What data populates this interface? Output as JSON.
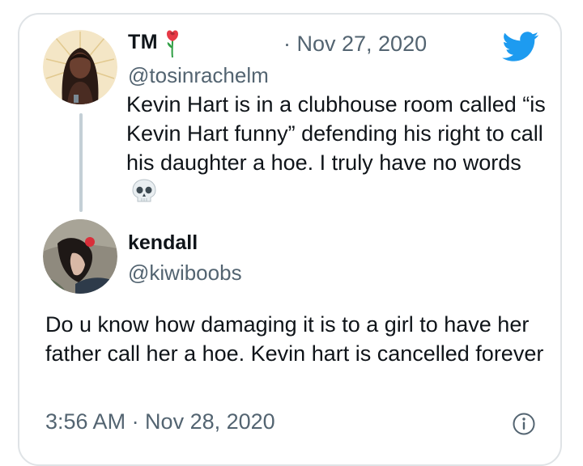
{
  "quoted_tweet": {
    "display_name": "TM",
    "name_icon": "rose-icon",
    "date": "· Nov 27, 2020",
    "handle": "@tosinrachelm",
    "text": "Kevin Hart is in a clubhouse room called “is Kevin Hart funny” defending his right to call his daughter a hoe. I truly have no words",
    "trailing_icon": "skull-icon"
  },
  "reply_tweet": {
    "display_name": "kendall",
    "handle": "@kiwiboobs",
    "text": "Do u know how damaging it is to a girl to have her father call her a hoe. Kevin hart is cancelled forever",
    "timestamp": "3:56 AM · Nov 28, 2020"
  },
  "icons": {
    "brand": "twitter-bird-icon",
    "info": "info-icon"
  },
  "colors": {
    "twitter_blue": "#1d9bf0",
    "secondary_text": "#536471",
    "border": "#dfe3e6"
  }
}
